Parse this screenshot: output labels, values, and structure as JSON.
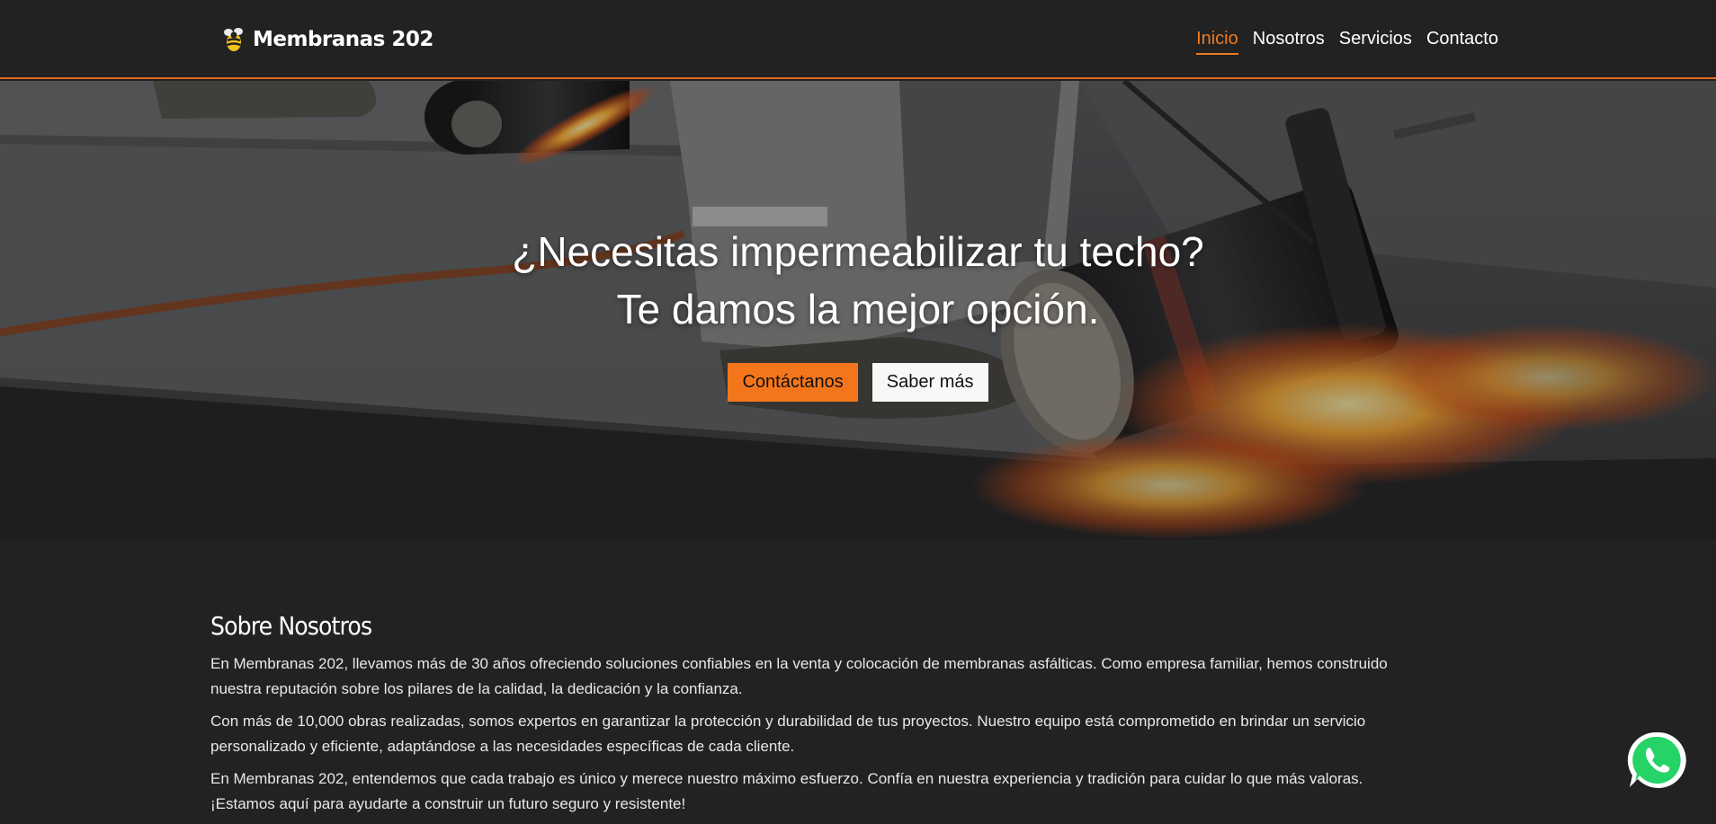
{
  "brand": {
    "name": "Membranas 202",
    "logo_icon": "bee-logo-icon"
  },
  "nav": {
    "items": [
      {
        "label": "Inicio",
        "active": true
      },
      {
        "label": "Nosotros",
        "active": false
      },
      {
        "label": "Servicios",
        "active": false
      },
      {
        "label": "Contacto",
        "active": false
      }
    ]
  },
  "hero": {
    "title_line1": "¿Necesitas impermeabilizar tu techo?",
    "title_line2": "Te damos la mejor opción.",
    "primary_button": "Contáctanos",
    "secondary_button": "Saber más"
  },
  "about": {
    "title": "Sobre Nosotros",
    "paragraphs": [
      "En Membranas 202, llevamos más de 30 años ofreciendo soluciones confiables en la venta y colocación de membranas asfálticas. Como empresa familiar, hemos construido nuestra reputación sobre los pilares de la calidad, la dedicación y la confianza.",
      "Con más de 10,000 obras realizadas, somos expertos en garantizar la protección y durabilidad de tus proyectos. Nuestro equipo está comprometido en brindar un servicio personalizado y eficiente, adaptándose a las necesidades específicas de cada cliente.",
      "En Membranas 202, entendemos que cada trabajo es único y merece nuestro máximo esfuerzo. Confía en nuestra experiencia y tradición para cuidar lo que más valoras. ¡Estamos aquí para ayudarte a construir un futuro seguro y resistente!"
    ]
  },
  "floating": {
    "whatsapp_icon": "whatsapp-icon"
  },
  "colors": {
    "background": "#222222",
    "accent": "#f4761c",
    "active_link": "#f07a1f",
    "whatsapp": "#25d366"
  }
}
